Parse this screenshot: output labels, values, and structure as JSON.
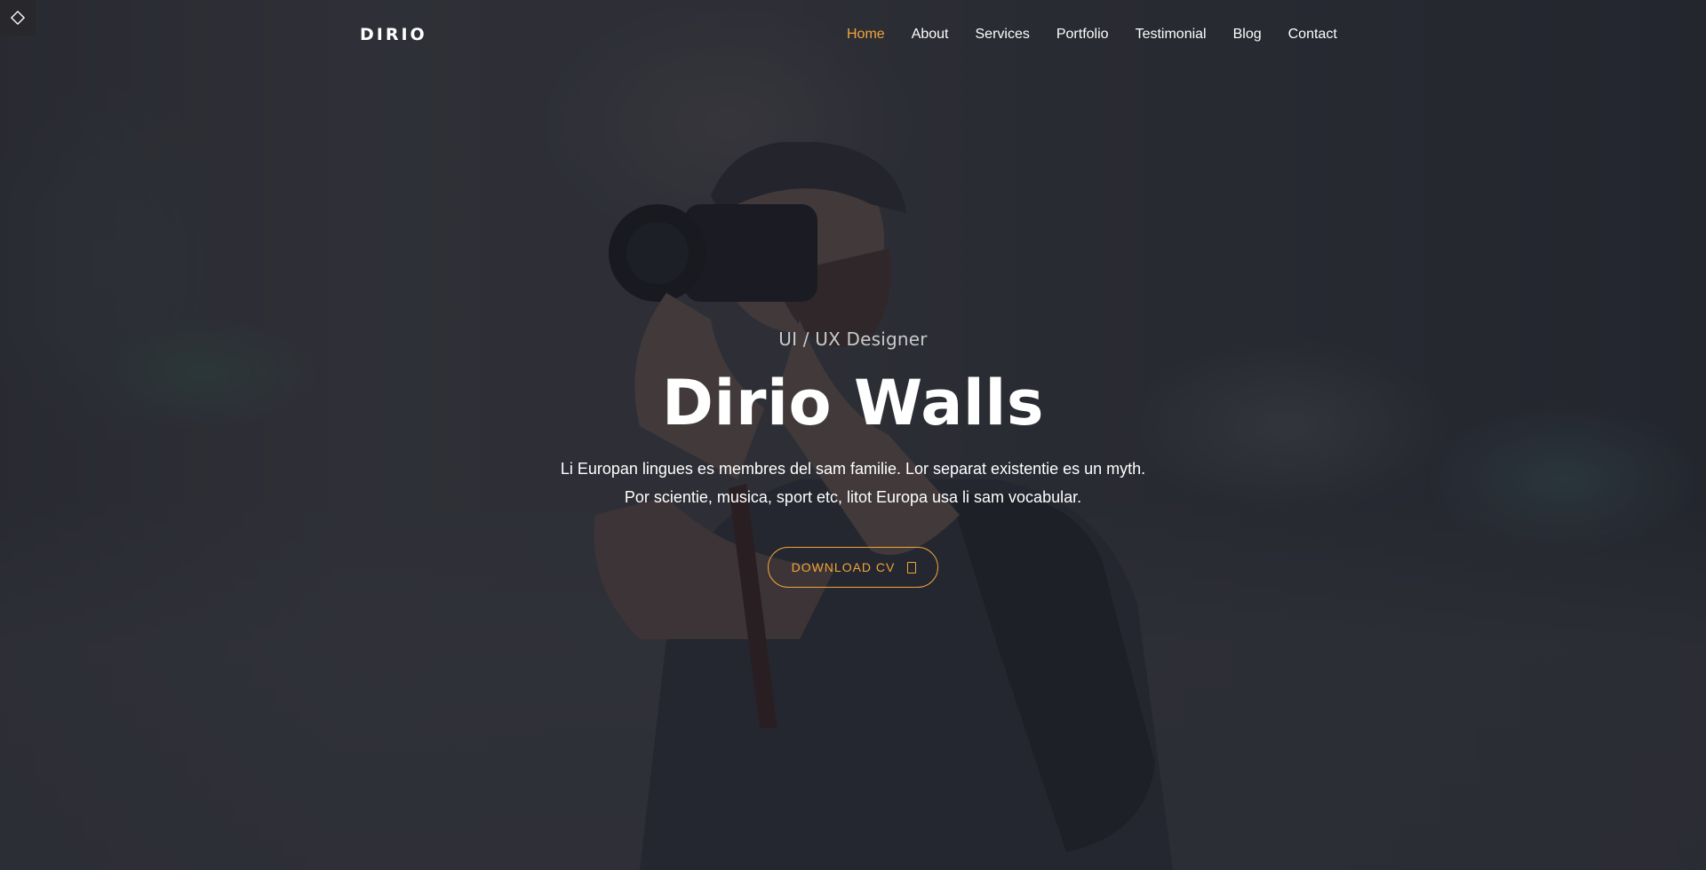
{
  "corner": {
    "icon": "diamond-icon"
  },
  "brand": {
    "logo": "DIRIO"
  },
  "nav": {
    "items": [
      {
        "label": "Home",
        "active": true
      },
      {
        "label": "About",
        "active": false
      },
      {
        "label": "Services",
        "active": false
      },
      {
        "label": "Portfolio",
        "active": false
      },
      {
        "label": "Testimonial",
        "active": false
      },
      {
        "label": "Blog",
        "active": false
      },
      {
        "label": "Contact",
        "active": false
      }
    ]
  },
  "hero": {
    "subtitle": "UI / UX Designer",
    "name": "Dirio Walls",
    "description": "Li Europan lingues es membres del sam familie. Lor separat existentie es un myth. Por scientie, musica, sport etc, litot Europa usa li sam vocabular.",
    "cta_label": "DOWNLOAD CV",
    "cta_icon": "file-icon"
  },
  "colors": {
    "accent": "#f2a43a",
    "overlay": "#1e212a",
    "text": "#ffffff"
  }
}
